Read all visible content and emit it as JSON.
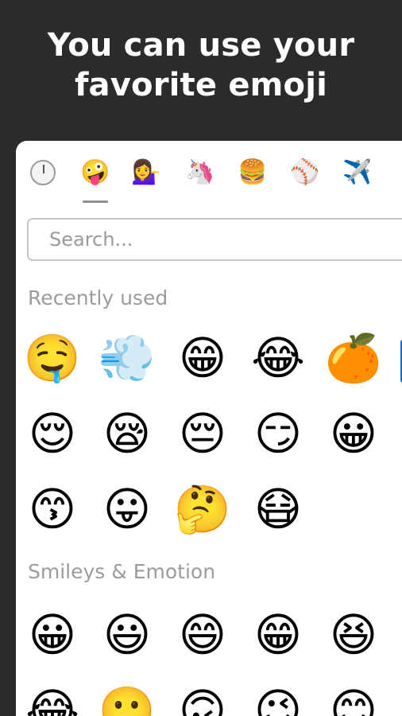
{
  "headline": {
    "line1": "You can use your",
    "line2": "favorite emoji"
  },
  "tabs": [
    {
      "name": "recent",
      "glyph": ""
    },
    {
      "name": "smileys",
      "glyph": "🤪"
    },
    {
      "name": "people",
      "glyph": "💁‍♀️"
    },
    {
      "name": "animals",
      "glyph": "🦄"
    },
    {
      "name": "food",
      "glyph": "🍔"
    },
    {
      "name": "activities",
      "glyph": "⚾"
    },
    {
      "name": "travel",
      "glyph": "✈️"
    }
  ],
  "search": {
    "placeholder": "Search...",
    "value": ""
  },
  "sections": {
    "recent": {
      "title": "Recently used",
      "items": [
        "🤤",
        "💨",
        "😁",
        "😂",
        "🍊",
        "😌",
        "😪",
        "😔",
        "😏",
        "😀",
        "😙",
        "😛",
        "🤔",
        "😷"
      ]
    },
    "smileys": {
      "title": "Smileys & Emotion",
      "items": [
        "😀",
        "😃",
        "😄",
        "😁",
        "😆",
        "😂",
        "🙂",
        "🙃",
        "😉",
        "😊"
      ]
    }
  }
}
